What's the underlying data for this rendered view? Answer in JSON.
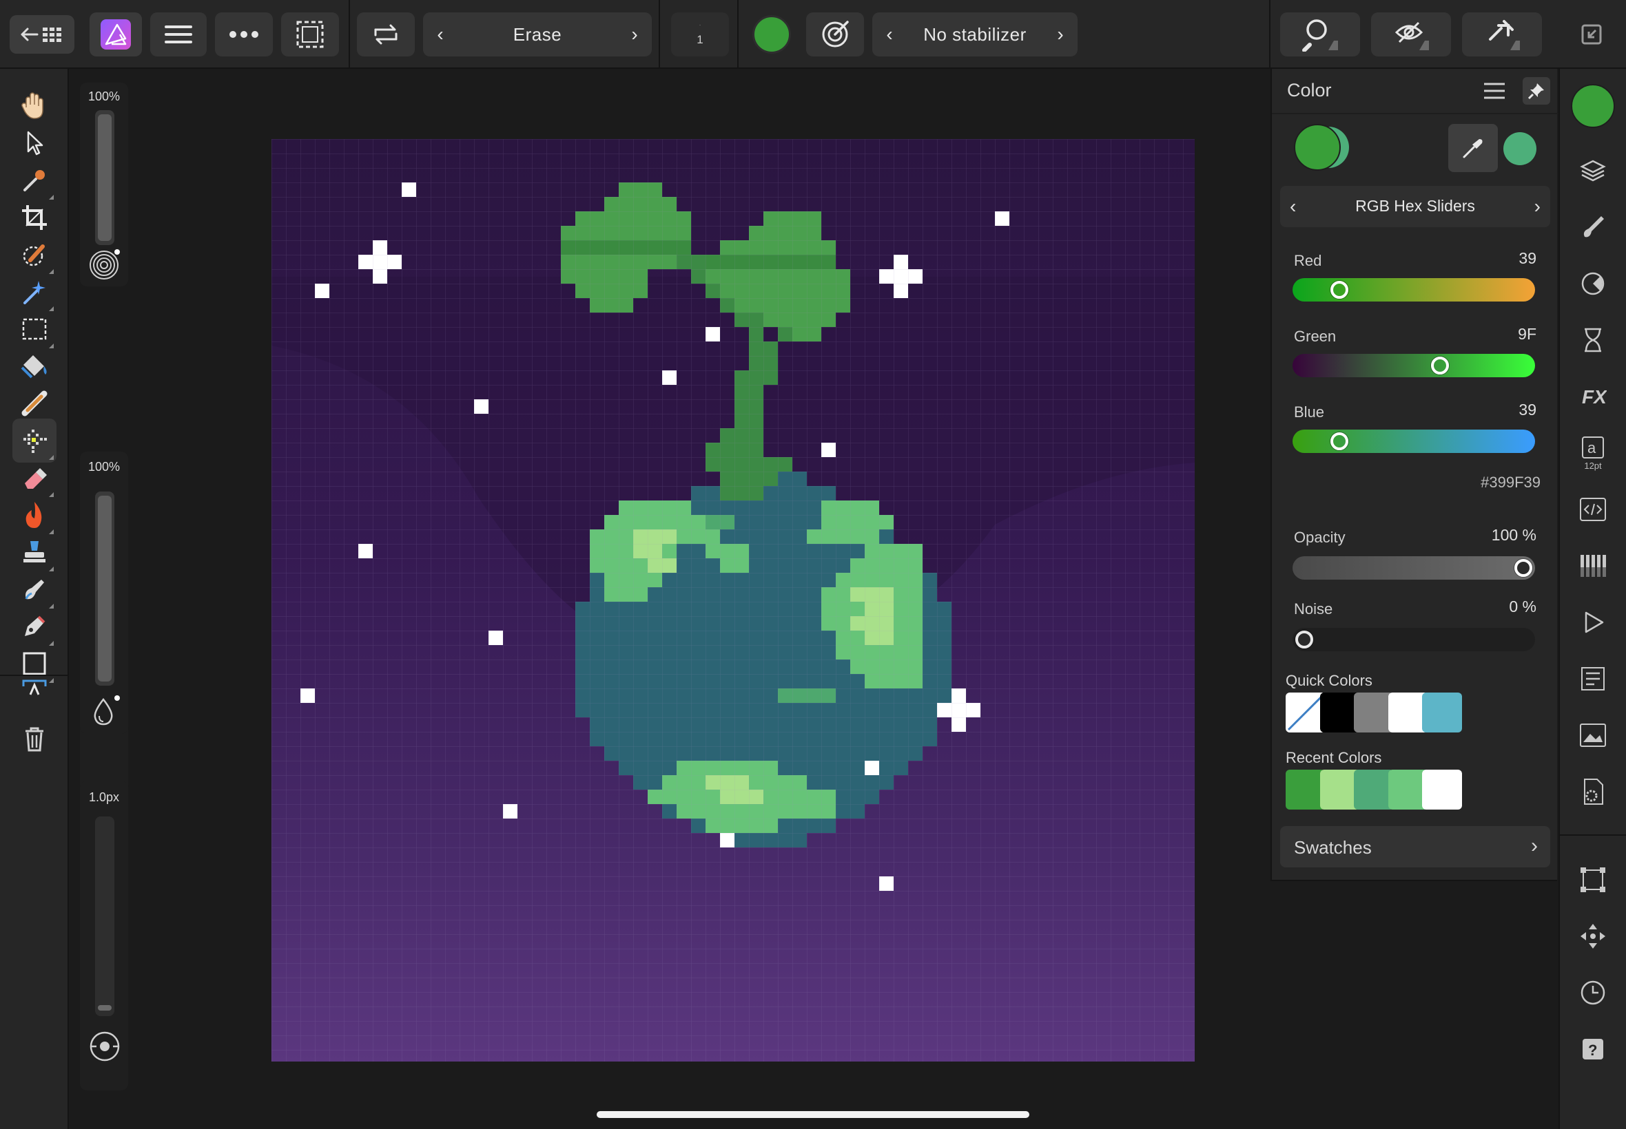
{
  "toolbar": {
    "tool_mode_label": "Erase",
    "layer_index": "1",
    "stabilizer_label": "No stabilizer",
    "current_color": "#399F39"
  },
  "context_strip": {
    "width_value": "100%",
    "opacity_value": "100%",
    "stroke_value": "1.0px"
  },
  "color_panel": {
    "title": "Color",
    "mode_label": "RGB Hex Sliders",
    "primary_color": "#399F39",
    "secondary_color": "#4DAF7A",
    "sliders": [
      {
        "label": "Red",
        "value": "39",
        "position": 0.16
      },
      {
        "label": "Green",
        "value": "9F",
        "position": 0.62
      },
      {
        "label": "Blue",
        "value": "39",
        "position": 0.16
      }
    ],
    "hex_value": "#399F39",
    "opacity_label": "Opacity",
    "opacity_value": "100 %",
    "opacity_position": 1.0,
    "noise_label": "Noise",
    "noise_value": "0 %",
    "noise_position": 0.0,
    "quick_colors_label": "Quick Colors",
    "quick_colors": [
      "none",
      "#000000",
      "#808080",
      "#FFFFFF",
      "#5DB5C8"
    ],
    "recent_colors_label": "Recent Colors",
    "recent_colors": [
      "#3A9E3C",
      "#A6E08A",
      "#4FAA78",
      "#6DC97E",
      "#FFFFFF"
    ],
    "swatches_label": "Swatches"
  },
  "right_column": {
    "text_size_label": "12pt"
  }
}
